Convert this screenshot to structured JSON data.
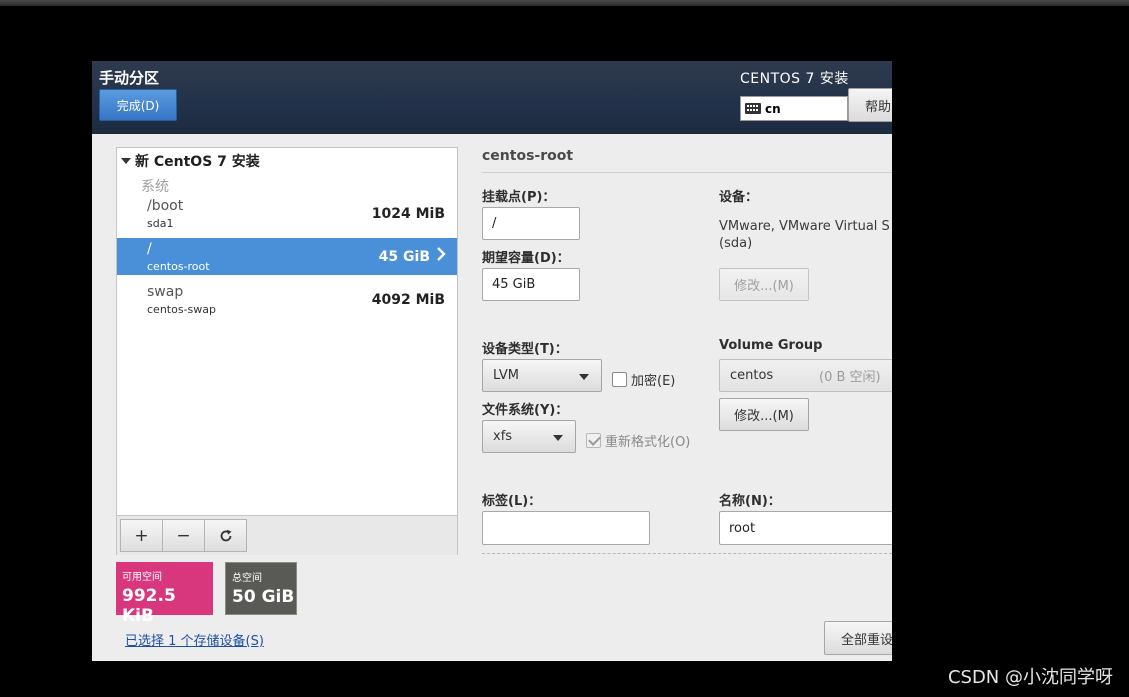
{
  "header": {
    "title": "手动分区",
    "done_label": "完成(D)",
    "product": "CENTOS 7 安装",
    "keyboard_layout": "cn",
    "help_label": "帮助"
  },
  "tree": {
    "root_label": "新 CentOS 7 安装",
    "group_label": "系统",
    "items": [
      {
        "mount": "/boot",
        "device": "sda1",
        "size": "1024 MiB"
      },
      {
        "mount": "/",
        "device": "centos-root",
        "size": "45 GiB"
      },
      {
        "mount": "swap",
        "device": "centos-swap",
        "size": "4092 MiB"
      }
    ],
    "toolbar": {
      "add": "+",
      "remove": "−",
      "refresh": "↻"
    }
  },
  "space": {
    "available_label": "可用空间",
    "available_value": "992.5 KiB",
    "total_label": "总空间",
    "total_value": "50 GiB"
  },
  "storage_link": "已选择 1 个存储设备(S)",
  "detail": {
    "title": "centos-root",
    "mount_label": "挂载点(P)：",
    "mount_value": "/",
    "capacity_label": "期望容量(D)：",
    "capacity_value": "45 GiB",
    "device_label": "设备：",
    "device_line1": "VMware, VMware Virtual S",
    "device_line2": "(sda)",
    "device_modify": "修改...(M)",
    "device_type_label": "设备类型(T)：",
    "device_type_value": "LVM",
    "encrypt_label": "加密(E)",
    "vg_label": "Volume Group",
    "vg_name": "centos",
    "vg_free": "(0 B 空闲)",
    "vg_modify": "修改...(M)",
    "fs_label": "文件系统(Y)：",
    "fs_value": "xfs",
    "reformat_label": "重新格式化(O)",
    "tag_label": "标签(L)：",
    "tag_value": "",
    "name_label": "名称(N)：",
    "name_value": "root",
    "reset_label": "全部重设"
  },
  "watermark": "CSDN @小沈同学呀"
}
